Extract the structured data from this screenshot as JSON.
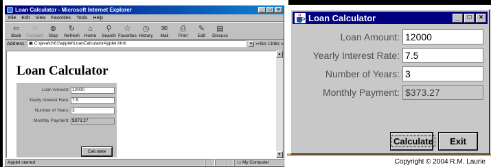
{
  "slide": {
    "copyright": "Copyright © 2004  R.M. Laurie"
  },
  "browser": {
    "title": "Loan Calculator - Microsoft Internet Explorer",
    "menu": [
      "File",
      "Edit",
      "View",
      "Favorites",
      "Tools",
      "Help"
    ],
    "toolbar": [
      {
        "label": "Back",
        "icon": "back-arrow-icon",
        "glyph": "⇦"
      },
      {
        "label": "Forward",
        "icon": "forward-arrow-icon",
        "glyph": "⇨"
      },
      {
        "label": "Stop",
        "icon": "stop-icon",
        "glyph": "⊗"
      },
      {
        "label": "Refresh",
        "icon": "refresh-icon",
        "glyph": "↻"
      },
      {
        "label": "Home",
        "icon": "home-icon",
        "glyph": "⌂"
      },
      {
        "label": "Search",
        "icon": "search-icon",
        "glyph": "⚲"
      },
      {
        "label": "Favorites",
        "icon": "favorites-icon",
        "glyph": "☆"
      },
      {
        "label": "History",
        "icon": "history-icon",
        "glyph": "◷"
      },
      {
        "label": "Mail",
        "icon": "mail-icon",
        "glyph": "✉"
      },
      {
        "label": "Print",
        "icon": "print-icon",
        "glyph": "⎙"
      },
      {
        "label": "Edit",
        "icon": "edit-icon",
        "glyph": "✎"
      },
      {
        "label": "Discuss",
        "icon": "discuss-icon",
        "glyph": "▤"
      }
    ],
    "address_label": "Address",
    "address": "C:\\java\\ch01\\applet\\LoanCalculatorApplet.html",
    "go_label": "Go",
    "links_label": "Links »",
    "status": "Applet started",
    "zone": "My Computer",
    "page_title": "Loan Calculator",
    "applet": {
      "fields": [
        {
          "label": "Loan Amount:",
          "value": "12000"
        },
        {
          "label": "Yearly Interest Rate:",
          "value": "7.5"
        },
        {
          "label": "Number of Years:",
          "value": "3"
        },
        {
          "label": "Monthly Payment:",
          "value": "$373.27"
        }
      ],
      "calculate_label": "Calculate"
    }
  },
  "app_window": {
    "title": "Loan Calculator",
    "fields": [
      {
        "label": "Loan Amount:",
        "value": "12000"
      },
      {
        "label": "Yearly Interest Rate:",
        "value": "7.5"
      },
      {
        "label": "Number of Years:",
        "value": "3"
      },
      {
        "label": "Monthly Payment:",
        "value": "$373.27"
      }
    ],
    "calculate_label": "Calculate",
    "exit_label": "Exit"
  },
  "colors": {
    "title_bar": "#000080",
    "panel_gray": "#c8c8c8",
    "accent_orange": "#f0a040"
  }
}
